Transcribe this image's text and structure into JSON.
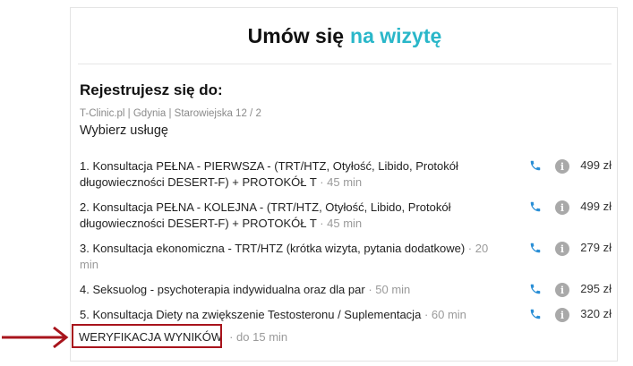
{
  "header": {
    "title_main": "Umów się",
    "title_accent": "na wizytę",
    "accent_color": "#2ab7c9"
  },
  "registration": {
    "title": "Rejestrujesz się do:",
    "clinic": "T-Clinic.pl | Gdynia | Starowiejska 12 / 2",
    "subtitle": "Wybierz usługę"
  },
  "services": [
    {
      "name": "1. Konsultacja PEŁNA - PIERWSZA - (TRT/HTZ, Otyłość, Libido, Protokół długowieczności DESERT-F) + PROTOKÓŁ T",
      "duration": "· 45 min",
      "price": "499 zł",
      "phone_icon": "phone-icon",
      "info_icon": "info-icon"
    },
    {
      "name": "2. Konsultacja PEŁNA - KOLEJNA - (TRT/HTZ, Otyłość, Libido, Protokół długowieczności DESERT-F) + PROTOKÓŁ T",
      "duration": "· 45 min",
      "price": "499 zł",
      "phone_icon": "phone-icon",
      "info_icon": "info-icon"
    },
    {
      "name": "3. Konsultacja ekonomiczna - TRT/HTZ (krótka wizyta, pytania dodatkowe)",
      "duration": "· 20 min",
      "price": "279 zł",
      "phone_icon": "phone-icon",
      "info_icon": "info-icon"
    },
    {
      "name": "4. Seksuolog - psychoterapia indywidualna oraz dla par",
      "duration": "· 50 min",
      "price": "295 zł",
      "phone_icon": "phone-icon",
      "info_icon": "info-icon"
    },
    {
      "name": "5. Konsultacja Diety na zwiększenie Testosteronu / Suplementacja",
      "duration": "· 60 min",
      "price": "320 zł",
      "phone_icon": "phone-icon",
      "info_icon": "info-icon"
    }
  ],
  "verification": {
    "label": "WERYFIKACJA WYNIKÓW",
    "duration": "· do 15 min"
  },
  "annotation": {
    "color": "#a8141c",
    "arrow_icon": "arrow-right-icon"
  }
}
